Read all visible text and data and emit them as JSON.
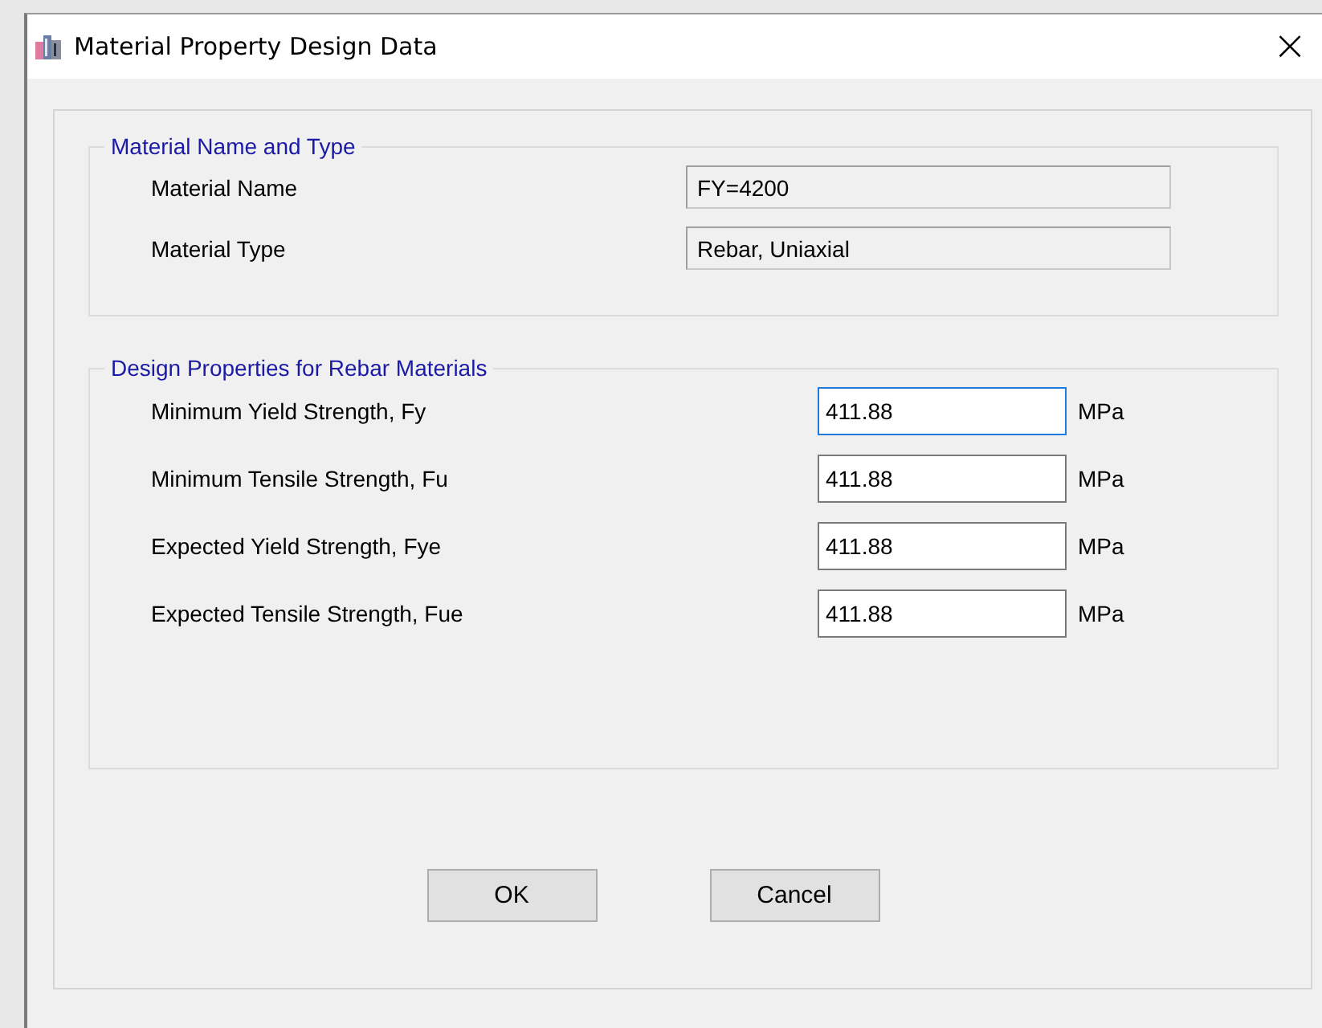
{
  "window": {
    "title": "Material Property Design Data",
    "close": "×"
  },
  "name_group": {
    "title": "Material Name and Type",
    "fields": [
      {
        "label": "Material Name",
        "value": "FY=4200"
      },
      {
        "label": "Material Type",
        "value": "Rebar, Uniaxial"
      }
    ]
  },
  "design_group": {
    "title": "Design Properties for Rebar Materials",
    "fields": [
      {
        "label": "Minimum Yield Strength, Fy",
        "value": "411.88",
        "unit": "MPa",
        "focused": true
      },
      {
        "label": "Minimum Tensile Strength, Fu",
        "value": "411.88",
        "unit": "MPa",
        "focused": false
      },
      {
        "label": "Expected Yield Strength, Fye",
        "value": "411.88",
        "unit": "MPa",
        "focused": false
      },
      {
        "label": "Expected Tensile Strength, Fue",
        "value": "411.88",
        "unit": "MPa",
        "focused": false
      }
    ]
  },
  "buttons": [
    "OK",
    "Cancel"
  ]
}
